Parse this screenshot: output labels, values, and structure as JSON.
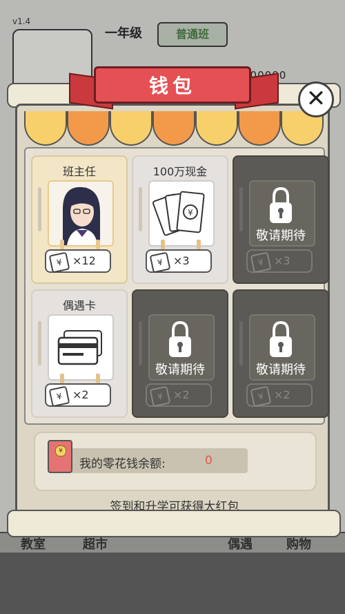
{
  "background": {
    "version": "v1.4",
    "grade": "一年级",
    "class_name": "普通班",
    "gold_partial": "000000",
    "bottom_tabs": [
      "教室",
      "超市",
      "偶遇",
      "购物"
    ]
  },
  "wallet": {
    "title": "钱包",
    "close_symbol": "✕",
    "cards": [
      {
        "title": "班主任",
        "count": "×12",
        "locked": false
      },
      {
        "title": "100万现金",
        "count": "×3",
        "locked": false
      },
      {
        "title": "",
        "count": "×3",
        "locked": true,
        "lock_text": "敬请期待"
      },
      {
        "title": "偶遇卡",
        "count": "×2",
        "locked": false
      },
      {
        "title": "",
        "count": "×2",
        "locked": true,
        "lock_text": "敬请期待"
      },
      {
        "title": "",
        "count": "×2",
        "locked": true,
        "lock_text": "敬请期待"
      }
    ],
    "ticket_symbol": "¥",
    "coin_symbol": "¥",
    "balance_label": "我的零花钱余额:",
    "balance_value": "0",
    "hint": "签到和升学可获得大红包"
  },
  "colors": {
    "ribbon": "#e55055",
    "awning_orange": "#f29a4a",
    "awning_yellow": "#f7cf6b",
    "balance_value": "#e05a4a"
  }
}
